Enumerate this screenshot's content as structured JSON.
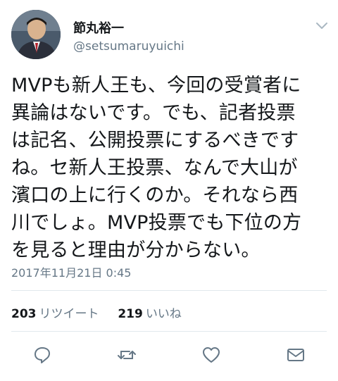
{
  "tweet": {
    "author_name": "節丸裕一",
    "author_handle": "@setsumaruyuichi",
    "text": "MVPも新人王も、今回の受賞者に\n異論はないです。でも、記者投票\nは記名、公開投票にするべきです\nね。セ新人王投票、なんで大山が\n濱口の上に行くのか。それなら西\n川でしょ。MVP投票でも下位の方\nを見ると理由が分からない。",
    "timestamp": "2017年11月21日 0:45"
  },
  "stats": {
    "retweets_count": "203",
    "retweets_label": "リツイート",
    "likes_count": "219",
    "likes_label": "いいね"
  },
  "icons": {
    "menu": "chevron-down-icon",
    "reply": "reply-icon",
    "retweet": "retweet-icon",
    "like": "heart-icon",
    "dm": "envelope-icon"
  },
  "colors": {
    "text": "#14171a",
    "secondary": "#657786",
    "divider": "#e1e8ed"
  }
}
